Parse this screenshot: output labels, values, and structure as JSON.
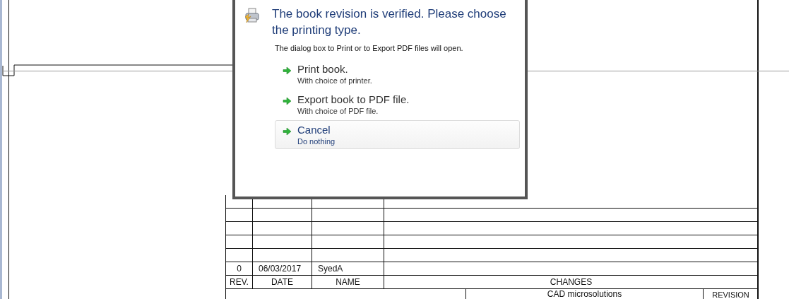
{
  "dialog": {
    "title": "The book revision is verified. Please choose the printing type.",
    "description": "The dialog box to Print or to Export PDF files will open.",
    "options": [
      {
        "title": "Print book.",
        "subtitle": "With choice of printer.",
        "selected": false
      },
      {
        "title": "Export book to PDF file.",
        "subtitle": "With choice of PDF file.",
        "selected": false
      },
      {
        "title": "Cancel",
        "subtitle": "Do nothing",
        "selected": true
      }
    ]
  },
  "revision_table": {
    "rows": [
      {
        "rev": "0",
        "date": "06/03/2017",
        "name": "SyedA"
      }
    ],
    "columns": [
      "REV.",
      "DATE",
      "NAME",
      "CHANGES"
    ]
  },
  "title_block": {
    "company": "CAD microsolutions",
    "column_3": "REVISION"
  }
}
